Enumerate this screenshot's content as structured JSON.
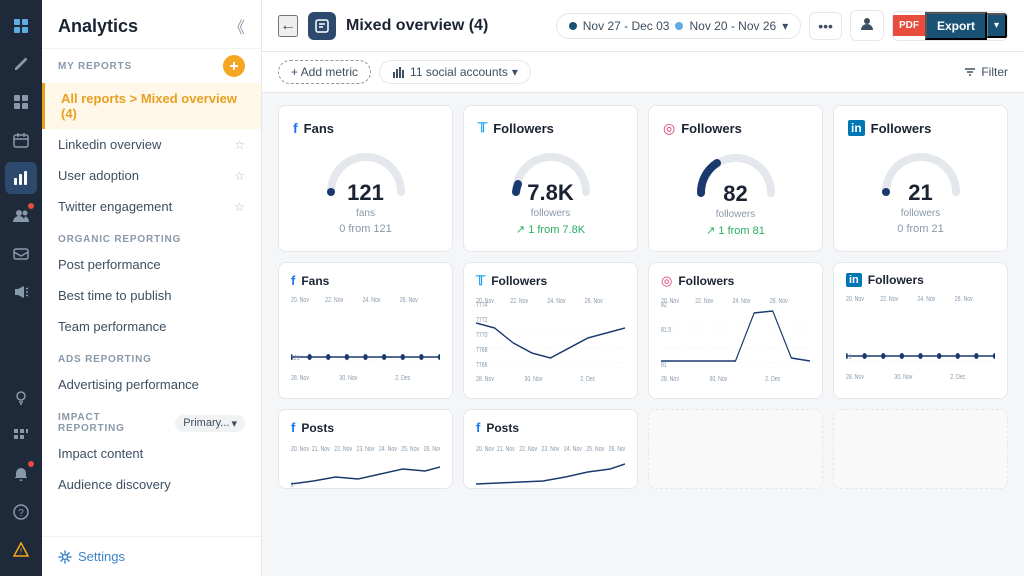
{
  "app": {
    "title": "Analytics"
  },
  "left_nav": {
    "icons": [
      {
        "name": "logo-icon",
        "symbol": "🔷",
        "active": false
      },
      {
        "name": "compose-icon",
        "symbol": "✏️",
        "active": false
      },
      {
        "name": "grid-icon",
        "symbol": "⊞",
        "active": false
      },
      {
        "name": "chart-icon",
        "symbol": "📊",
        "active": true
      },
      {
        "name": "calendar-icon",
        "symbol": "📅",
        "active": false
      },
      {
        "name": "people-icon",
        "symbol": "👥",
        "active": false,
        "badge": true
      },
      {
        "name": "inbox-icon",
        "symbol": "📥",
        "active": false
      },
      {
        "name": "megaphone-icon",
        "symbol": "📣",
        "active": false
      },
      {
        "name": "analytics-icon",
        "symbol": "📈",
        "active": false
      },
      {
        "name": "bulb-icon",
        "symbol": "💡",
        "active": false
      },
      {
        "name": "apps-icon",
        "symbol": "⊞",
        "active": false
      },
      {
        "name": "bell-icon",
        "symbol": "🔔",
        "active": false,
        "badge": true
      },
      {
        "name": "help-icon",
        "symbol": "?",
        "active": false
      },
      {
        "name": "warning-icon",
        "symbol": "⚠️",
        "active": false,
        "highlight": true
      }
    ]
  },
  "sidebar": {
    "title": "Analytics",
    "my_reports_label": "MY REPORTS",
    "active_item": "All reports > Mixed overview (4)",
    "items": [
      {
        "id": "linkedin-overview",
        "label": "Linkedin overview",
        "has_star": true
      },
      {
        "id": "user-adoption",
        "label": "User adoption",
        "has_star": true
      },
      {
        "id": "twitter-engagement",
        "label": "Twitter engagement",
        "has_star": true
      }
    ],
    "organic_label": "ORGANIC REPORTING",
    "organic_items": [
      {
        "id": "post-performance",
        "label": "Post performance"
      },
      {
        "id": "best-time",
        "label": "Best time to publish"
      },
      {
        "id": "team-performance",
        "label": "Team performance"
      }
    ],
    "ads_label": "ADS REPORTING",
    "ads_items": [
      {
        "id": "advertising",
        "label": "Advertising performance"
      }
    ],
    "impact_label": "IMPACT REPORTING",
    "impact_dropdown": "Primary...",
    "impact_items": [
      {
        "id": "impact-content",
        "label": "Impact content"
      },
      {
        "id": "audience-discovery",
        "label": "Audience discovery"
      }
    ],
    "settings_label": "Settings"
  },
  "topbar": {
    "back_label": "←",
    "report_icon": "📊",
    "report_title": "Mixed overview (4)",
    "date_range_primary": "Nov 27 - Dec 03",
    "date_range_secondary": "Nov 20 - Nov 26",
    "more_label": "•••",
    "share_label": "👤",
    "export_pdf_label": "PDF",
    "export_label": "Export",
    "export_caret": "▾"
  },
  "filterbar": {
    "add_metric_label": "+ Add metric",
    "accounts_label": "11 social accounts",
    "accounts_icon": "📊",
    "filter_label": "Filter",
    "filter_icon": "▼"
  },
  "metrics": [
    {
      "platform": "facebook",
      "platform_color": "#1877f2",
      "platform_symbol": "f",
      "name": "Fans",
      "value": "121",
      "value_sub": "fans",
      "change": "0 from 121",
      "change_type": "neutral",
      "gauge_percent": 0
    },
    {
      "platform": "twitter",
      "platform_color": "#1da1f2",
      "platform_symbol": "𝕏",
      "name": "Followers",
      "value": "7.8K",
      "value_sub": "followers",
      "change": "↗ 1 from 7.8K",
      "change_type": "up",
      "gauge_percent": 5
    },
    {
      "platform": "instagram",
      "platform_color": "#e1306c",
      "platform_symbol": "◎",
      "name": "Followers",
      "value": "82",
      "value_sub": "followers",
      "change": "↗ 1 from 81",
      "change_type": "up",
      "gauge_percent": 20
    },
    {
      "platform": "linkedin",
      "platform_color": "#0077b5",
      "platform_symbol": "in",
      "name": "Followers",
      "value": "21",
      "value_sub": "followers",
      "change": "0 from 21",
      "change_type": "neutral",
      "gauge_percent": 0
    }
  ],
  "charts": [
    {
      "platform": "facebook",
      "platform_color": "#1877f2",
      "platform_symbol": "f",
      "name": "Fans",
      "x_labels": [
        "20. Nov",
        "22. Nov",
        "24. Nov",
        "26. Nov"
      ],
      "x_labels_bottom": [
        "28. Nov",
        "30. Nov",
        "2. Dec"
      ],
      "y_labels": [
        "",
        "121"
      ],
      "value": "121",
      "flat_line": true
    },
    {
      "platform": "twitter",
      "platform_color": "#1da1f2",
      "platform_symbol": "𝕏",
      "name": "Followers",
      "x_labels": [
        "20. Nov",
        "22. Nov",
        "24. Nov",
        "26. Nov"
      ],
      "x_labels_bottom": [
        "28. Nov",
        "30. Nov",
        "2. Dec"
      ],
      "y_labels": [
        "7774",
        "7772",
        "7770",
        "7768",
        "7766"
      ],
      "has_dip": true
    },
    {
      "platform": "instagram",
      "platform_color": "#e1306c",
      "platform_symbol": "◎",
      "name": "Followers",
      "x_labels": [
        "20. Nov",
        "22. Nov",
        "24. Nov",
        "26. Nov"
      ],
      "x_labels_bottom": [
        "28. Nov",
        "30. Nov",
        "2. Dec"
      ],
      "y_labels": [
        "82",
        "81.5",
        "81"
      ],
      "has_spike": true
    },
    {
      "platform": "linkedin",
      "platform_color": "#0077b5",
      "platform_symbol": "in",
      "name": "Followers",
      "x_labels": [
        "20. Nov",
        "22. Nov",
        "24. Nov",
        "26. Nov"
      ],
      "x_labels_bottom": [
        "28. Nov",
        "30. Nov",
        "2. Dec"
      ],
      "y_labels": [
        "",
        "21"
      ],
      "flat_line": true
    }
  ],
  "posts_row": [
    {
      "platform": "facebook",
      "platform_color": "#1877f2",
      "platform_symbol": "f",
      "name": "Posts",
      "x_labels": [
        "20. Nov",
        "21. Nov",
        "22. Nov",
        "23. Nov",
        "24. Nov",
        "25. Nov",
        "26. Nov"
      ]
    },
    {
      "platform": "facebook",
      "platform_color": "#1877f2",
      "platform_symbol": "f",
      "name": "Posts",
      "x_labels": [
        "20. Nov",
        "21. Nov",
        "22. Nov",
        "23. Nov",
        "24. Nov",
        "25. Nov",
        "26. Nov"
      ]
    }
  ]
}
